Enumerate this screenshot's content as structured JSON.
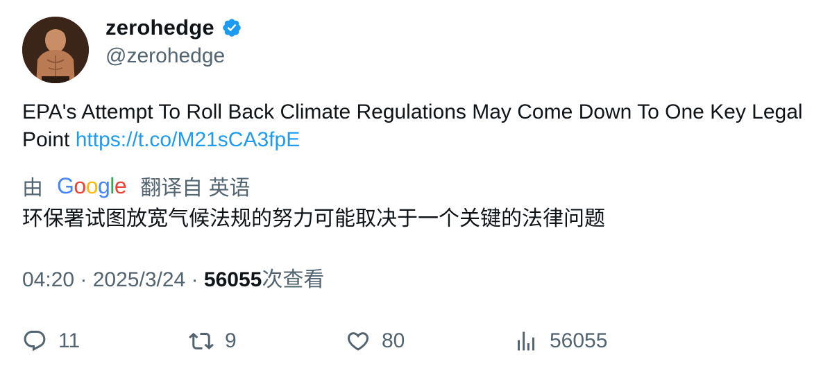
{
  "author": {
    "display_name": "zerohedge",
    "handle": "@zerohedge",
    "verified": true,
    "verified_color": "#1d9bf0"
  },
  "tweet": {
    "text": "EPA's Attempt To Roll Back Climate Regulations May Come Down To One Key Legal Point ",
    "link": "https://t.co/M21sCA3fpE",
    "link_color": "#1d9bf0"
  },
  "translation": {
    "prefix": "由",
    "provider": "Google",
    "suffix": "翻译自 英语",
    "text": "环保署试图放宽气候法规的努力可能取决于一个关键的法律问题"
  },
  "meta": {
    "time": "04:20",
    "separator1": " · ",
    "date": "2025/3/24",
    "separator2": " · ",
    "views_count": "56055",
    "views_label": "次查看"
  },
  "actions": {
    "replies": "11",
    "retweets": "9",
    "likes": "80",
    "views": "56055"
  },
  "icons": {
    "reply": "reply-icon",
    "retweet": "retweet-icon",
    "like": "heart-icon",
    "views": "analytics-icon",
    "verified": "verified-badge-icon"
  }
}
